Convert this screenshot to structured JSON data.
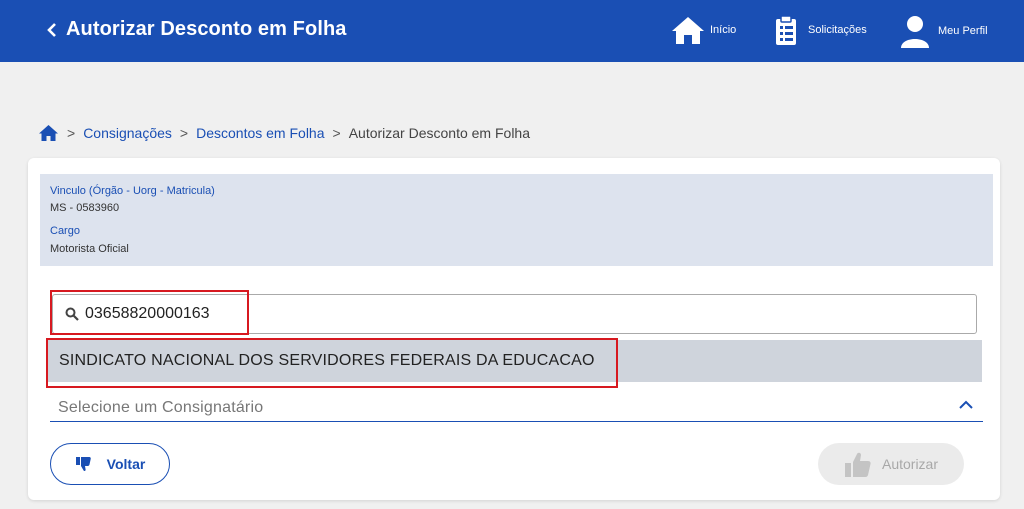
{
  "header": {
    "title": "Autorizar Desconto em Folha",
    "nav": [
      {
        "label": "Início",
        "icon": "home-icon"
      },
      {
        "label": "Solicitações",
        "icon": "clipboard-icon"
      },
      {
        "label": "Meu Perfil",
        "icon": "user-icon"
      }
    ]
  },
  "breadcrumb": {
    "home_icon": "home-icon",
    "items": [
      "Consignações",
      "Descontos em Folha",
      "Autorizar Desconto em Folha"
    ],
    "separator": ">"
  },
  "info": {
    "vinculo_label": "Vinculo (Órgão - Uorg - Matricula)",
    "vinculo_value": "MS - 0583960",
    "cargo_label": "Cargo",
    "cargo_value": "Motorista Oficial"
  },
  "search": {
    "value": "03658820000163",
    "icon": "search-icon"
  },
  "dropdown": {
    "option": "SINDICATO NACIONAL DOS SERVIDORES FEDERAIS DA EDUCACAO",
    "placeholder": "Selecione um Consignatário"
  },
  "buttons": {
    "voltar": "Voltar",
    "autorizar": "Autorizar"
  },
  "colors": {
    "primary": "#1a4fb4",
    "highlight": "#d71920",
    "info_bg": "#dde3ee",
    "option_bg": "#cfd4dc"
  }
}
